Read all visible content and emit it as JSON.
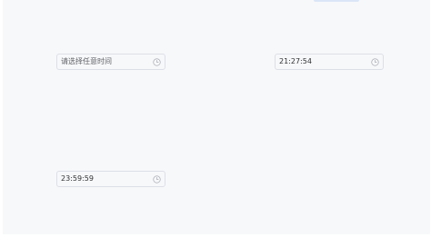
{
  "pickers": [
    {
      "value": "",
      "placeholder": "请选择任意时间",
      "display": "请选择任意时间",
      "icon": "clock-icon"
    },
    {
      "value": "21:27:54",
      "placeholder": "",
      "display": "21:27:54",
      "icon": "clock-icon"
    },
    {
      "value": "23:59:59",
      "placeholder": "",
      "display": "23:59:59",
      "icon": "clock-icon"
    }
  ],
  "colors": {
    "background": "#f7f8fa",
    "border": "#dcdfe6",
    "text": "#303133",
    "icon": "#a8abb2"
  }
}
